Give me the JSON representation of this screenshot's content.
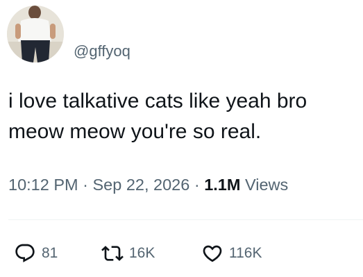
{
  "tweet": {
    "handle": "@gffyoq",
    "text": "i love talkative cats like yeah bro\nmeow meow you're so real.",
    "time": "10:12 PM",
    "separator": "·",
    "date": "Sep 22, 2026",
    "views_count": "1.1M",
    "views_label": "Views"
  },
  "actions": {
    "replies": "81",
    "retweets": "16K",
    "likes": "116K"
  },
  "icons": {
    "reply": "speech-bubble-icon",
    "retweet": "retweet-arrows-icon",
    "like": "heart-icon"
  },
  "colors": {
    "text_primary": "#0f1419",
    "text_secondary": "#536471",
    "divider": "#eff3f4"
  }
}
